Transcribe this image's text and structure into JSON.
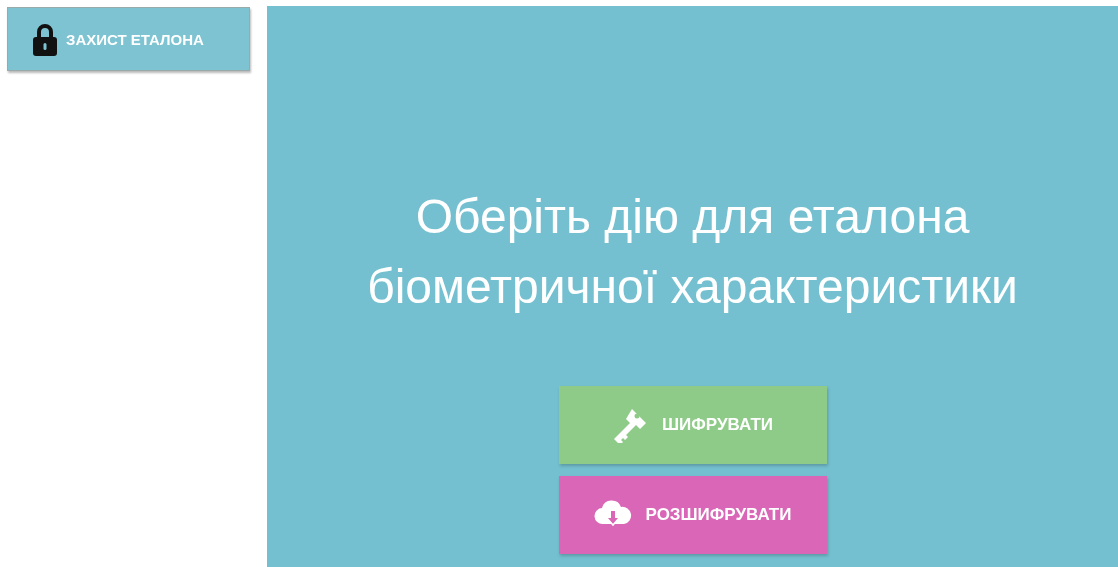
{
  "sidebar": {
    "button": {
      "label": "ЗАХИСТ ЕТАЛОНА",
      "kind": "lock"
    }
  },
  "main": {
    "heading": "Оберіть дію для еталона біометричної характеристики",
    "actions": [
      {
        "label": "ШИФРУВАТИ",
        "kind": "encrypt",
        "color": "#8fcb88"
      },
      {
        "label": "РОЗШИФРУВАТИ",
        "kind": "decrypt",
        "color": "#d966b6"
      }
    ]
  }
}
